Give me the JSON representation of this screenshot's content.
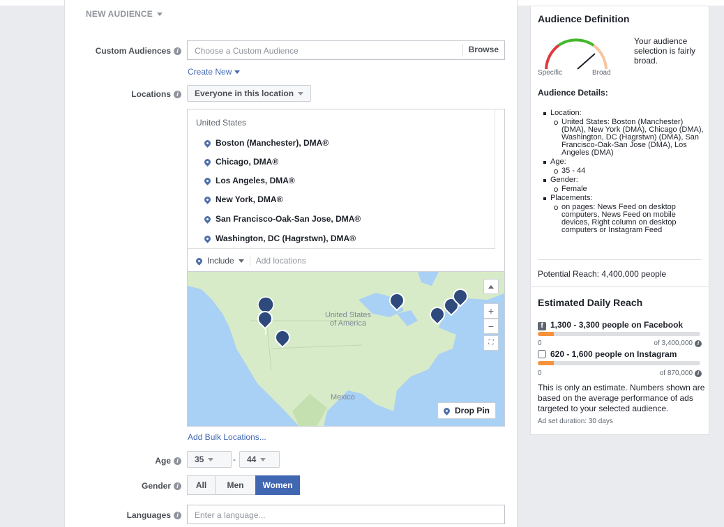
{
  "section": {
    "title": "NEW AUDIENCE"
  },
  "custom_audiences": {
    "label": "Custom Audiences",
    "placeholder": "Choose a Custom Audience",
    "browse_label": "Browse",
    "create_new_label": "Create New"
  },
  "locations": {
    "label": "Locations",
    "type_selected": "Everyone in this location",
    "country": "United States",
    "items": [
      "Boston (Manchester), DMA®",
      "Chicago, DMA®",
      "Los Angeles, DMA®",
      "New York, DMA®",
      "San Francisco-Oak-San Jose, DMA®",
      "Washington, DC (Hagrstwn), DMA®"
    ],
    "include_label": "Include",
    "add_placeholder": "Add locations",
    "map": {
      "label_us_line1": "United States",
      "label_us_line2": "of America",
      "label_mexico": "Mexico",
      "drop_pin_label": "Drop Pin",
      "zoom_in": "+",
      "zoom_out": "−"
    },
    "bulk_label": "Add Bulk Locations..."
  },
  "age": {
    "label": "Age",
    "min": "35",
    "max": "44",
    "separator": "-"
  },
  "gender": {
    "label": "Gender",
    "options": [
      "All",
      "Men",
      "Women"
    ],
    "selected": "Women"
  },
  "languages": {
    "label": "Languages",
    "placeholder": "Enter a language..."
  },
  "side": {
    "definition_title": "Audience Definition",
    "gauge_specific": "Specific",
    "gauge_broad": "Broad",
    "gauge_text": "Your audience selection is fairly broad.",
    "details_title": "Audience Details:",
    "details": {
      "location_label": "Location:",
      "location_value": "United States: Boston (Manchester) (DMA), New York (DMA), Chicago (DMA), Washington, DC (Hagrstwn) (DMA), San Francisco-Oak-San Jose (DMA), Los Angeles (DMA)",
      "age_label": "Age:",
      "age_value": "35 - 44",
      "gender_label": "Gender:",
      "gender_value": "Female",
      "placements_label": "Placements:",
      "placements_value": "on pages: News Feed on desktop computers, News Feed on mobile devices, Right column on desktop computers or Instagram Feed"
    },
    "potential_reach": "Potential Reach: 4,400,000 people",
    "daily_title": "Estimated Daily Reach",
    "facebook_reach": "1,300 - 3,300 people on Facebook",
    "facebook_min": "0",
    "facebook_max": "of 3,400,000",
    "facebook_fill": 0.1,
    "instagram_reach": "620 - 1,600 people on Instagram",
    "instagram_min": "0",
    "instagram_max": "of 870,000",
    "instagram_fill": 0.1,
    "estimate_note": "This is only an estimate. Numbers shown are based on the average performance of ads targeted to your selected audience.",
    "duration": "Ad set duration: 30 days"
  },
  "colors": {
    "accent": "#4267b2",
    "bar_fill": "#f7923a",
    "map_water": "#a9d0f5",
    "map_land": "#d8ebc8",
    "pin": "#2e4a7d"
  }
}
